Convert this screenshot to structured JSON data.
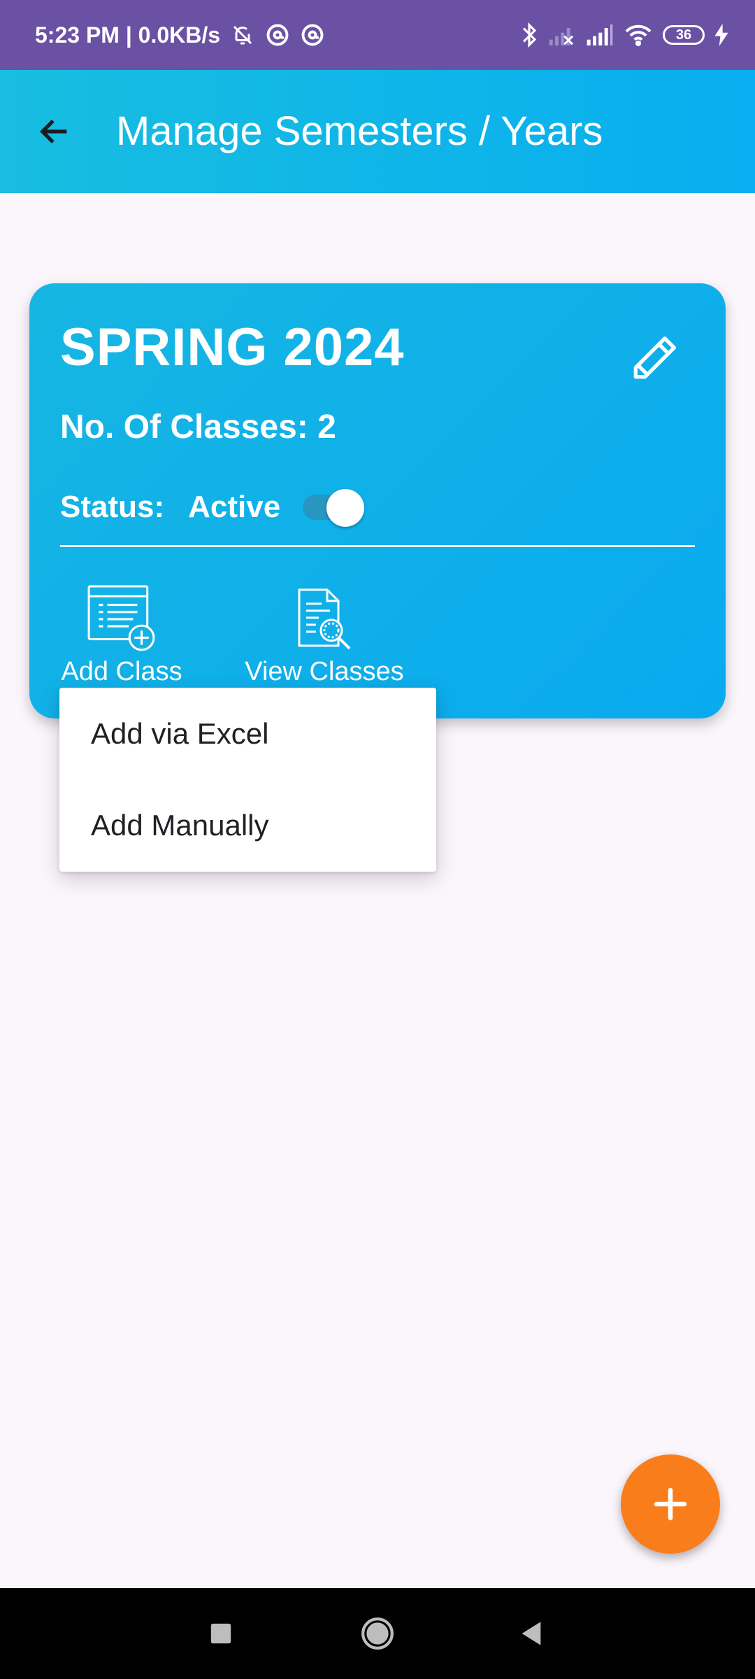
{
  "status_bar": {
    "time_speed": "5:23 PM | 0.0KB/s",
    "battery": "36",
    "icons": [
      "alarm-off-icon",
      "at-icon",
      "at-icon",
      "bluetooth-icon",
      "signal-off-icon",
      "signal-icon",
      "wifi-icon",
      "battery-icon",
      "charging-icon"
    ]
  },
  "app_bar": {
    "title": "Manage Semesters / Years",
    "back_icon": "arrow-left-icon",
    "background": "#0ab0ee"
  },
  "card": {
    "title": "SPRING 2024",
    "classes_label": "No. Of Classes: 2",
    "status_label": "Status:",
    "status_value": "Active",
    "status_on": true,
    "edit_icon": "pencil-icon",
    "actions": [
      {
        "label": "Add Class",
        "icon": "add-class-icon"
      },
      {
        "label": "View Classes",
        "icon": "view-document-icon"
      }
    ]
  },
  "popup_menu": {
    "items": [
      {
        "label": "Add via Excel"
      },
      {
        "label": "Add Manually"
      }
    ]
  },
  "fab": {
    "icon": "plus-icon",
    "color": "#f97e1b"
  },
  "nav_bar": {
    "icons": [
      "recent-apps-icon",
      "home-icon",
      "back-icon"
    ]
  }
}
